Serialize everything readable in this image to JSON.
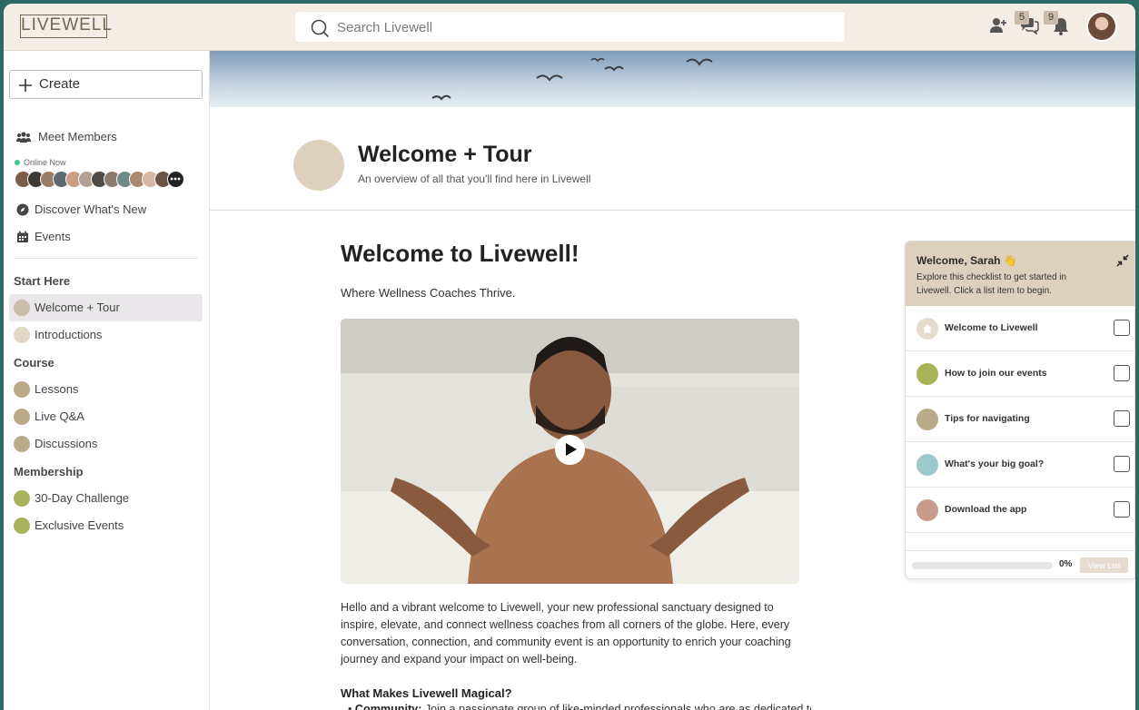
{
  "app": {
    "logo_text": "LIVEWELL"
  },
  "topbar": {
    "search_placeholder": "Search Livewell",
    "messages_badge": "5",
    "notifications_badge": "9"
  },
  "sidebar": {
    "create_label": "Create",
    "meet_members_label": "Meet Members",
    "online_now_label": "Online Now",
    "discover_label": "Discover What's New",
    "events_label": "Events",
    "sections": [
      {
        "title": "Start Here",
        "items": [
          {
            "label": "Welcome + Tour",
            "color": "#c9bca8",
            "active": true
          },
          {
            "label": "Introductions",
            "color": "#e3d6c4",
            "active": false
          }
        ]
      },
      {
        "title": "Course",
        "items": [
          {
            "label": "Lessons",
            "color": "#b9ab88",
            "active": false
          },
          {
            "label": "Live Q&A",
            "color": "#b9ab88",
            "active": false
          },
          {
            "label": "Discussions",
            "color": "#b9ab88",
            "active": false
          }
        ]
      },
      {
        "title": "Membership",
        "items": [
          {
            "label": "30-Day Challenge",
            "color": "#a9b35a",
            "active": false
          },
          {
            "label": "Exclusive Events",
            "color": "#a9b35a",
            "active": false
          }
        ]
      }
    ]
  },
  "page": {
    "title": "Welcome + Tour",
    "subtitle": "An overview of all that you'll find here in Livewell",
    "heading": "Welcome to Livewell!",
    "tagline": "Where Wellness Coaches Thrive.",
    "intro": "Hello and a vibrant welcome to Livewell, your new professional sanctuary designed to inspire, elevate, and connect wellness coaches from all corners of the globe. Here, every conversation, connection, and community event is an opportunity to enrich your coaching journey and expand your impact on well-being.",
    "subheading": "What Makes Livewell Magical?",
    "bullet_bold": "Community:",
    "bullet_text": " Join a passionate group of like-minded professionals who are as dedicated to"
  },
  "checklist": {
    "title": "Welcome, Sarah 👋",
    "description": "Explore this checklist to get started in Livewell. Click a list item to begin.",
    "items": [
      {
        "label": "Welcome to Livewell",
        "color": "#e5dccf"
      },
      {
        "label": "How to join our events",
        "color": "#a9b35a"
      },
      {
        "label": "Tips for navigating",
        "color": "#b9ab88"
      },
      {
        "label": "What's your big goal?",
        "color": "#9ec9cc"
      },
      {
        "label": "Download the app",
        "color": "#c99b8c"
      }
    ],
    "progress_label": "0%",
    "progress_value": 0,
    "view_list_label": "View List"
  }
}
